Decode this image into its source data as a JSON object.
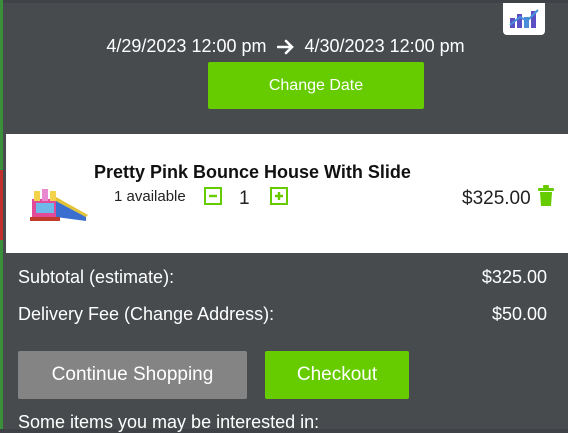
{
  "dates": {
    "start": "4/29/2023 12:00 pm",
    "end": "4/30/2023 12:00 pm",
    "change_label": "Change Date"
  },
  "cart_item": {
    "name": "Pretty Pink Bounce House With Slide",
    "availability": "1 available",
    "quantity": "1",
    "price": "$325.00"
  },
  "totals": {
    "subtotal_label": "Subtotal (estimate):",
    "subtotal_value": "$325.00",
    "delivery_label": "Delivery Fee (Change Address):",
    "delivery_value": "$50.00"
  },
  "actions": {
    "continue_label": "Continue Shopping",
    "checkout_label": "Checkout"
  },
  "suggestions_heading": "Some items you may be interested in:",
  "colors": {
    "accent": "#66cc00",
    "panel": "#474b4e",
    "secondary_button": "#848484"
  },
  "icons": [
    "brand-logo-icon",
    "arrow-right-icon",
    "minus-icon",
    "plus-icon",
    "trash-icon"
  ]
}
